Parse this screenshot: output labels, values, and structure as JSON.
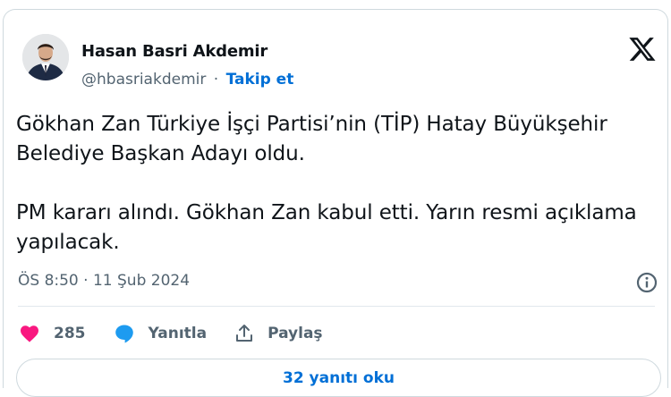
{
  "author": {
    "name": "Hasan Basri Akdemir",
    "handle": "@hbasriakdemir",
    "separator": "·",
    "follow_label": "Takip et"
  },
  "icons": {
    "brand": "x-logo-icon",
    "info": "info-icon",
    "like": "heart-icon",
    "reply": "speech-bubble-icon",
    "share": "share-icon"
  },
  "tweet": {
    "paragraphs": [
      "Gökhan Zan Türkiye İşçi Partisi’nin (TİP) Hatay Büyükşehir Belediye Başkan Adayı oldu.",
      "PM kararı alındı. Gökhan Zan kabul etti. Yarın resmi açıklama yapılacak."
    ],
    "timestamp": "ÖS 8:50 · 11 Şub 2024"
  },
  "actions": {
    "likes": "285",
    "reply_label": "Yanıtla",
    "share_label": "Paylaş"
  },
  "replies_button": "32 yanıtı oku",
  "colors": {
    "text": "#0f1419",
    "muted": "#536471",
    "link": "#006fd6",
    "like": "#f91880",
    "reply": "#1d9bf0",
    "border": "#cfd9de"
  }
}
